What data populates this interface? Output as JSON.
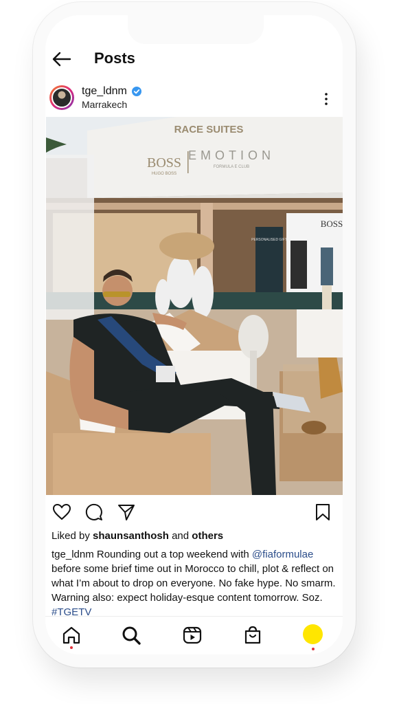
{
  "header": {
    "title": "Posts",
    "back_icon": "arrow-left-icon"
  },
  "post": {
    "username": "tge_ldnm",
    "verified": true,
    "location": "Marrakech",
    "photo_signs": {
      "tent_banner": "RACE SUITES",
      "brand": "BOSS",
      "brand_sub": "HUGO BOSS",
      "partner": "EMOTION",
      "partner_sub": "FORMULA E CLUB",
      "booth_sign": "PERSONALISED GIFT",
      "booth_brand": "BOSS"
    },
    "likes": {
      "prefix": "Liked by ",
      "user": "shaunsanthosh",
      "middle": " and ",
      "others": "others"
    },
    "caption": {
      "user": "tge_ldnm",
      "text1": " Rounding out a top weekend with ",
      "mention": "@fiaformulae",
      "text2": " before some brief time out in Morocco to chill, plot & reflect on what I’m about to drop on everyone. No fake hype. No smarm. Warning also: expect holiday-esque content tomorrow. Soz. ",
      "hashtag": "#TGETV"
    }
  },
  "bottom_nav": [
    "home-icon",
    "search-icon",
    "reels-icon",
    "shop-icon",
    "profile-avatar"
  ],
  "colors": {
    "accent_link": "#2b4d8a",
    "verified": "#3897f0",
    "notification_dot": "#e0313a",
    "profile": "#ffe600"
  }
}
